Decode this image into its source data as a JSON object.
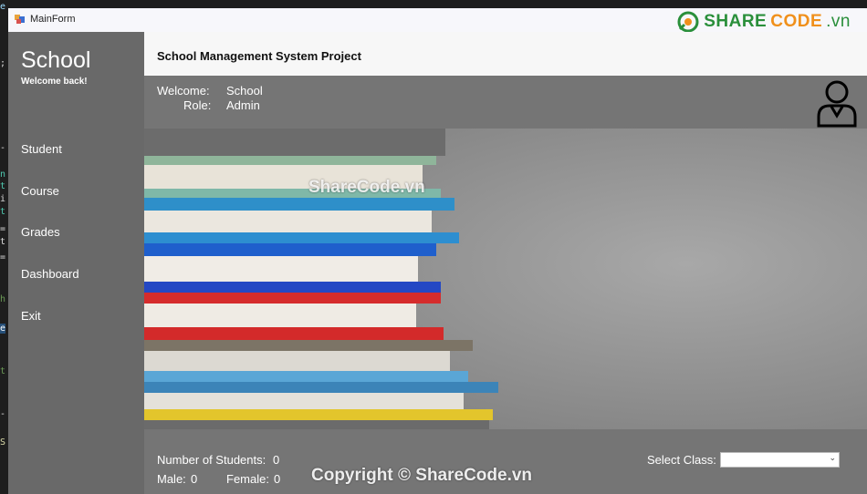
{
  "window": {
    "title": "MainForm"
  },
  "watermark": {
    "brand_share": "SHARE",
    "brand_code": "CODE",
    "brand_tld": ".vn"
  },
  "sidebar": {
    "app_name": "School",
    "welcome_back": "Welcome back!",
    "items": [
      {
        "label": "Student"
      },
      {
        "label": "Course"
      },
      {
        "label": "Grades"
      },
      {
        "label": "Dashboard"
      },
      {
        "label": "Exit"
      }
    ]
  },
  "header": {
    "title": "School Management System Project"
  },
  "user_info": {
    "welcome_label": "Welcome:",
    "welcome_value": "School",
    "role_label": "Role:",
    "role_value": "Admin",
    "avatar_icon": "user-icon"
  },
  "hero": {
    "watermark": "ShareCode.vn"
  },
  "stats": {
    "students_label": "Number of Students:",
    "students_value": "0",
    "male_label": "Male:",
    "male_value": "0",
    "female_label": "Female:",
    "female_value": "0",
    "select_class_label": "Select Class:",
    "select_class_value": ""
  },
  "copyright": "Copyright © ShareCode.vn",
  "colors": {
    "sidebar_bg": "#696969",
    "panel_bg": "#757575",
    "header_bg": "#f7f7f7",
    "brand_green": "#2a8f3b",
    "brand_orange": "#f0901c"
  }
}
